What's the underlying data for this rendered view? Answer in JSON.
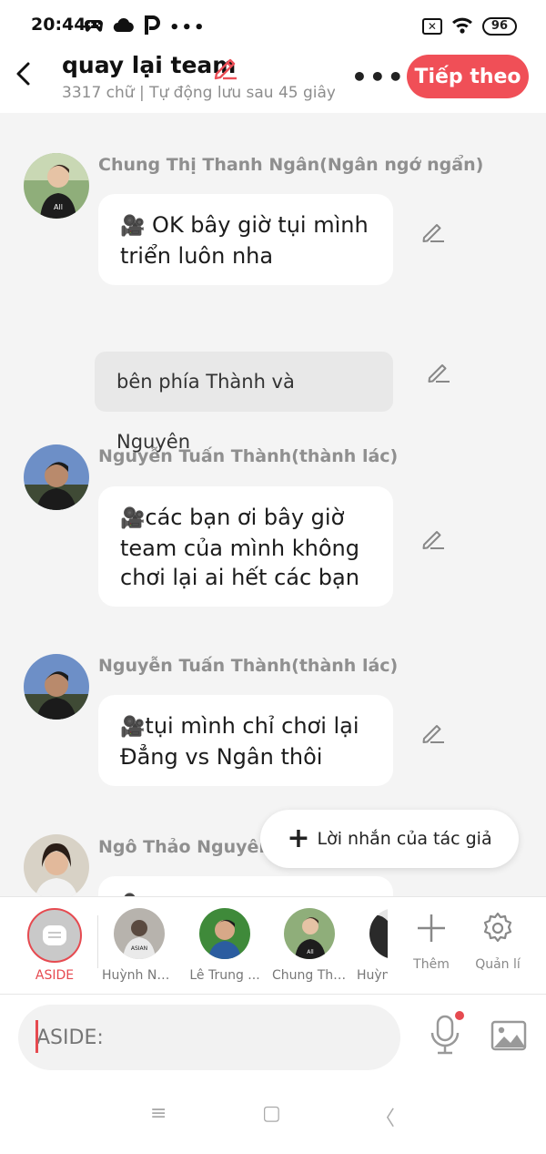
{
  "status_bar": {
    "time": "20:44",
    "battery": "96"
  },
  "header": {
    "title": "quay lại team",
    "subtitle": "3317 chữ | Tự động lưu sau 45 giây",
    "more": "•••",
    "next_label": "Tiếp theo"
  },
  "messages": [
    {
      "type": "character",
      "name": "Chung Thị Thanh Ngân(Ngân ngớ ngẩn)",
      "camera": "🎥",
      "text": "OK bây giờ tụi mình triển luôn nha"
    },
    {
      "type": "aside",
      "text": "bên phía Thành và Nguyên"
    },
    {
      "type": "character",
      "name": "Nguyễn Tuấn Thành(thành lác)",
      "camera": "🎥",
      "text": "các bạn ơi bây giờ team của mình không chơi lại ai hết các bạn"
    },
    {
      "type": "character",
      "name": "Nguyễn Tuấn Thành(thành lác)",
      "camera": "🎥",
      "text": "tụi mình chỉ chơi lại Đẳng vs Ngân thôi"
    },
    {
      "type": "character",
      "name": "Ngô Thảo Nguyên",
      "camera": "🎥",
      "text": ""
    }
  ],
  "author_note_label": "Lời nhắn của tác giả",
  "characters_bar": {
    "aside_label": "ASIDE",
    "characters": [
      "Huỳnh Ng...",
      "Lê Trung ...",
      "Chung Thị...",
      "Huỳnh"
    ],
    "add_label": "Thêm",
    "manage_label": "Quản lí"
  },
  "input": {
    "placeholder": "ASIDE:"
  },
  "nav": {
    "menu": "≡",
    "home": "▢",
    "back": "〈"
  },
  "colors": {
    "accent": "#f04f57",
    "aside_red": "#e64a50"
  }
}
